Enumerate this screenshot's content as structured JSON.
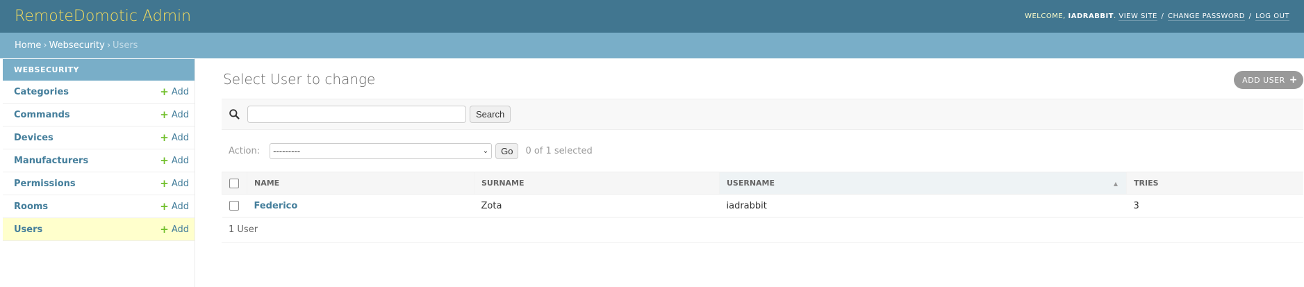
{
  "header": {
    "brand": "RemoteDomotic Admin",
    "welcome": "Welcome,",
    "username": "iadrabbit",
    "view_site": "View site",
    "change_password": "Change password",
    "log_out": "Log out",
    "separator": "/"
  },
  "breadcrumbs": {
    "home": "Home",
    "app": "Websecurity",
    "current": "Users",
    "separator": "›"
  },
  "sidebar": {
    "caption": "Websecurity",
    "add_label": "Add",
    "items": [
      {
        "label": "Categories"
      },
      {
        "label": "Commands"
      },
      {
        "label": "Devices"
      },
      {
        "label": "Manufacturers"
      },
      {
        "label": "Permissions"
      },
      {
        "label": "Rooms"
      },
      {
        "label": "Users"
      }
    ]
  },
  "content": {
    "title": "Select User to change",
    "add_button": "Add user"
  },
  "search": {
    "value": "",
    "button": "Search"
  },
  "actions": {
    "label": "Action:",
    "selected": "---------",
    "go": "Go",
    "counter": "0 of 1 selected"
  },
  "table": {
    "columns": [
      "Name",
      "Surname",
      "Username",
      "Tries"
    ],
    "rows": [
      {
        "name": "Federico",
        "surname": "Zota",
        "username": "iadrabbit",
        "tries": "3"
      }
    ]
  },
  "paginator": "1 User",
  "colors": {
    "header_bg": "#417690",
    "brand": "#f5dd5d",
    "breadcrumbs_bg": "#79aec8",
    "link": "#447e9b",
    "add_icon": "#70bf2b",
    "current_row": "#ffffcc"
  }
}
